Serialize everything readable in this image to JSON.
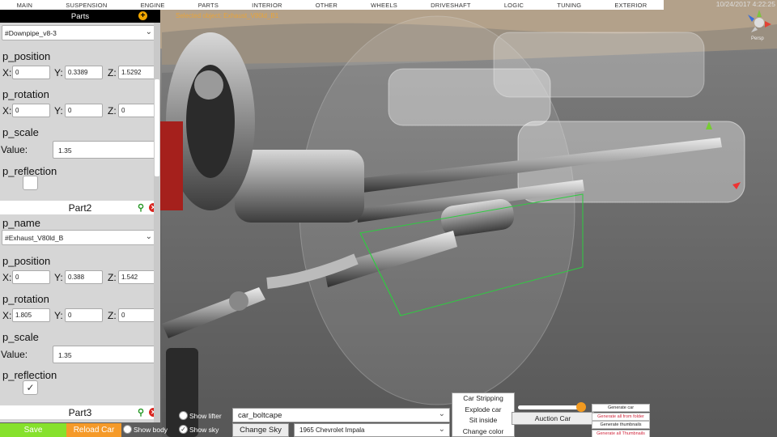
{
  "top_menu": {
    "items": [
      "MAIN",
      "SUSPENSION",
      "ENGINE",
      "PARTS",
      "INTERIOR",
      "OTHER",
      "WHEELS",
      "DRIVESHAFT",
      "LOGIC",
      "TUNING",
      "EXTERIOR"
    ],
    "timestamp": "10/24/2017 4:22:25"
  },
  "selected_info": "Selected object: Exhaust_V80ld_B1",
  "gizmo": {
    "label": "Persp"
  },
  "panel": {
    "title": "Parts",
    "part1": {
      "name_value": "#Downpipe_v8-3",
      "position_label": "p_position",
      "position": {
        "x": "0",
        "y": "0.3389",
        "z": "1.5292"
      },
      "rotation_label": "p_rotation",
      "rotation": {
        "x": "0",
        "y": "0",
        "z": "0"
      },
      "scale_label": "p_scale",
      "value_label": "Value:",
      "scale_value": "1.35",
      "reflection_label": "p_reflection",
      "reflection_checked": false
    },
    "part2": {
      "title": "Part2",
      "name_label": "p_name",
      "name_value": "#Exhaust_V80ld_B",
      "position_label": "p_position",
      "position": {
        "x": "0",
        "y": "0.388",
        "z": "1.542"
      },
      "rotation_label": "p_rotation",
      "rotation": {
        "x": "1.805",
        "y": "0",
        "z": "0"
      },
      "scale_label": "p_scale",
      "value_label": "Value:",
      "scale_value": "1.35",
      "reflection_label": "p_reflection",
      "reflection_checked": true,
      "check_glyph": "✓"
    },
    "part3": {
      "title": "Part3"
    },
    "axis_labels": {
      "x": "X:",
      "y": "Y:",
      "z": "Z:"
    }
  },
  "bottom": {
    "save_label": "Save",
    "reload_label": "Reload Car",
    "show_body_label": "Show body",
    "show_lifter_label": "Show lifter",
    "show_sky_label": "Show sky",
    "show_sky_checked": true,
    "check_glyph": "✓",
    "sky_select_value": "car_boltcape",
    "change_sky_label": "Change Sky",
    "car_select_value": "1965 Chevrolet Impala",
    "menu_items": [
      "Car Stripping",
      "Explode car",
      "Sit inside",
      "Change color"
    ],
    "auction_label": "Auction Car",
    "slider_value": 0.95,
    "generate_items": [
      "Generate car",
      "Generate all from folder",
      "Generate thumbnails",
      "Generate all Thumbnails"
    ],
    "generate_colors": [
      "#222222",
      "#d0263c",
      "#222222",
      "#d0263c"
    ]
  }
}
